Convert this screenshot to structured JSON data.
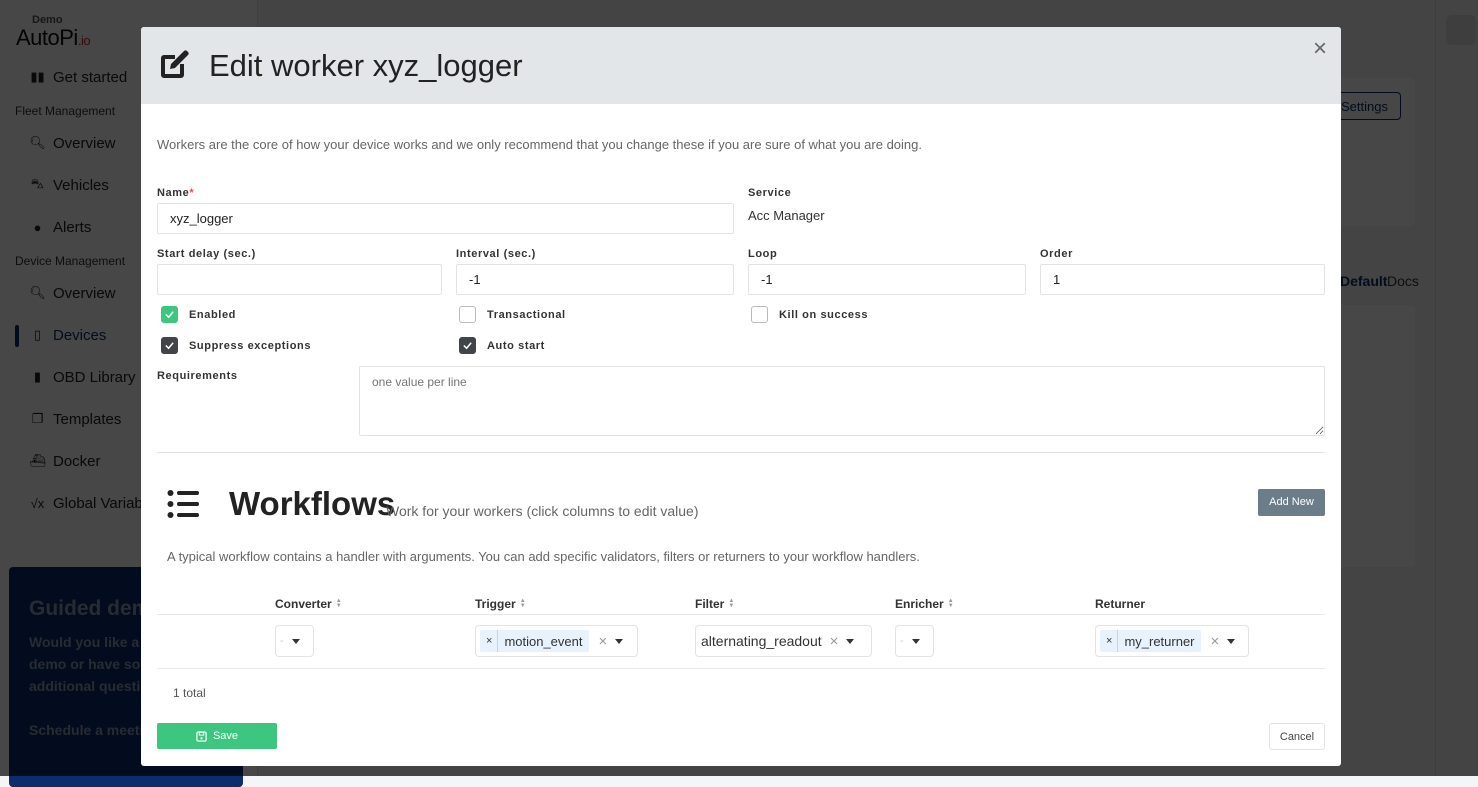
{
  "background": {
    "logo": {
      "demo": "Demo",
      "brand": "AutoPi",
      "suffix": ".io"
    },
    "nav": [
      {
        "label": "Get started",
        "icon": "book-icon"
      },
      {
        "section": "Fleet Management"
      },
      {
        "label": "Overview",
        "icon": "search-chart-icon"
      },
      {
        "label": "Vehicles",
        "icon": "car-icon"
      },
      {
        "label": "Alerts",
        "icon": "exclamation-icon"
      },
      {
        "section": "Device Management"
      },
      {
        "label": "Overview",
        "icon": "search-chart-icon"
      },
      {
        "label": "Devices",
        "icon": "devices-icon",
        "active": true
      },
      {
        "label": "OBD Library",
        "icon": "book-icon"
      },
      {
        "label": "Templates",
        "icon": "copy-icon"
      },
      {
        "label": "Docker",
        "icon": "docker-icon"
      },
      {
        "label": "Global Variables",
        "icon": "sqrt-x-icon"
      }
    ],
    "promo": {
      "title": "Guided demo",
      "text1": "Would you like a guided demo or have some additional questions?",
      "text2": "Schedule a meeting directly."
    },
    "settings_button": "Settings",
    "default_tab": "Default",
    "docs_tab": "Docs"
  },
  "modal": {
    "title": "Edit worker xyz_logger",
    "close_label": "×",
    "intro": "Workers are the core of how your device works and we only recommend that you change these if you are sure of what you are doing.",
    "fields": {
      "name": {
        "label": "Name",
        "required_mark": "*",
        "value": "xyz_logger"
      },
      "service": {
        "label": "Service",
        "value": "Acc Manager"
      },
      "start_delay": {
        "label": "Start delay (sec.)",
        "value": ""
      },
      "interval": {
        "label": "Interval (sec.)",
        "value": "-1"
      },
      "loop": {
        "label": "Loop",
        "value": "-1"
      },
      "order": {
        "label": "Order",
        "value": "1"
      },
      "requirements": {
        "label": "Requirements",
        "placeholder": "one value per line",
        "value": ""
      }
    },
    "checkboxes": {
      "enabled": {
        "label": "Enabled",
        "checked": true
      },
      "transactional": {
        "label": "Transactional",
        "checked": false
      },
      "kill_on_success": {
        "label": "Kill on success",
        "checked": false
      },
      "suppress_exceptions": {
        "label": "Suppress exceptions",
        "checked": true
      },
      "auto_start": {
        "label": "Auto start",
        "checked": true
      }
    },
    "workflows": {
      "title": "Workflows",
      "subtitle": "Work for your workers (click columns to edit value)",
      "add_new": "Add New",
      "description": "A typical workflow contains a handler with arguments. You can add specific validators, filters or returners to your workflow handlers.",
      "columns": [
        "Converter",
        "Trigger",
        "Filter",
        "Enricher",
        "Returner"
      ],
      "rows": [
        {
          "converter": "-",
          "trigger": "motion_event",
          "filter": "alternating_readout",
          "enricher": "-",
          "returner": "my_returner"
        }
      ],
      "total": "1 total"
    },
    "save_label": "Save",
    "cancel_label": "Cancel"
  }
}
